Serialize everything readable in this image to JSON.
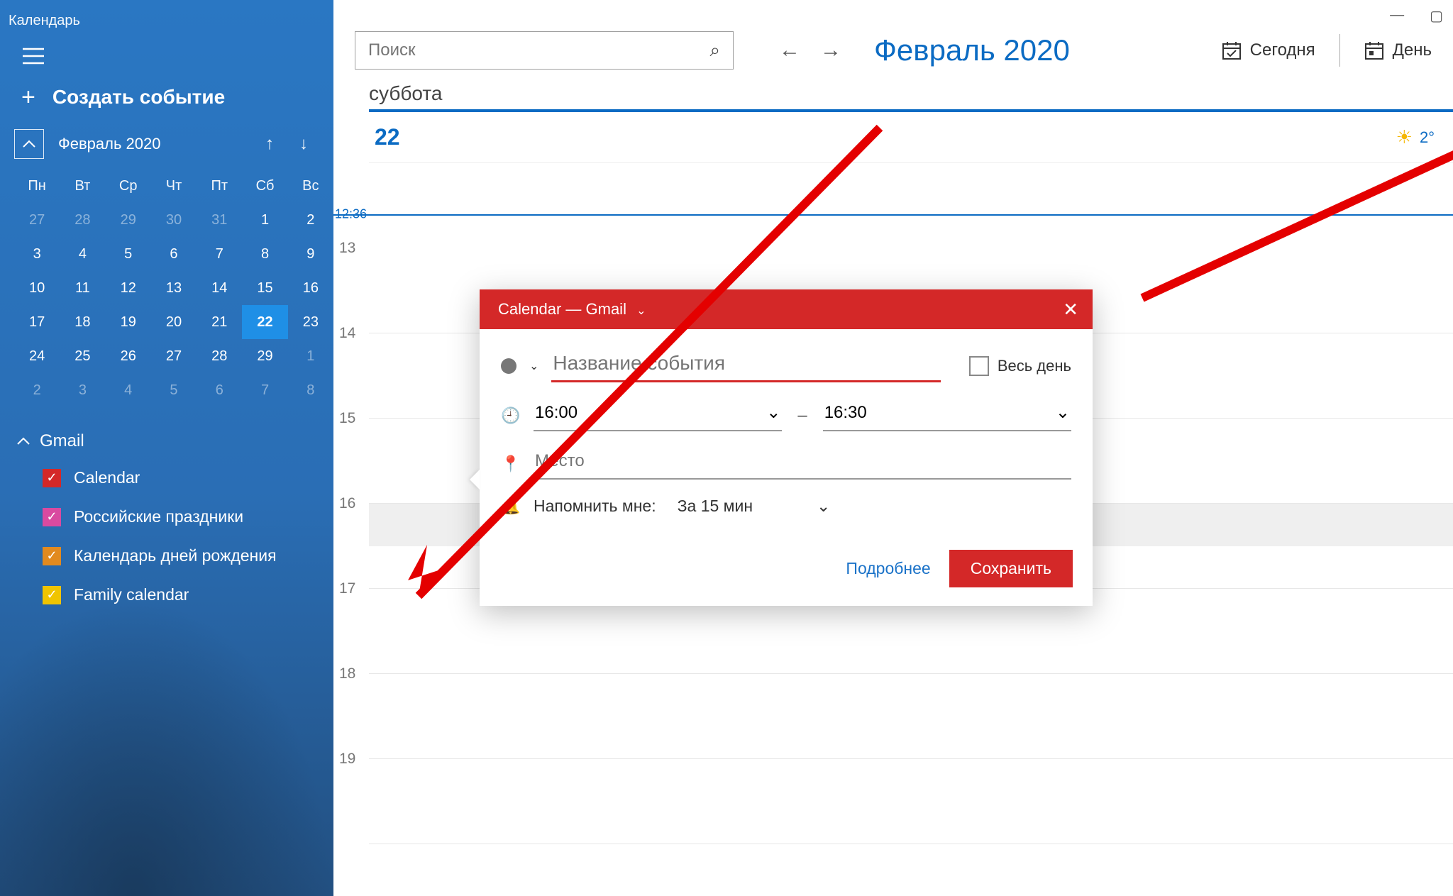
{
  "app_title": "Календарь",
  "create_event_label": "Создать событие",
  "mini_month_label": "Февраль 2020",
  "weekdays": [
    "Пн",
    "Вт",
    "Ср",
    "Чт",
    "Пт",
    "Сб",
    "Вс"
  ],
  "mini_cal_rows": [
    [
      {
        "d": "27",
        "dim": true
      },
      {
        "d": "28",
        "dim": true
      },
      {
        "d": "29",
        "dim": true
      },
      {
        "d": "30",
        "dim": true
      },
      {
        "d": "31",
        "dim": true
      },
      {
        "d": "1"
      },
      {
        "d": "2"
      }
    ],
    [
      {
        "d": "3"
      },
      {
        "d": "4"
      },
      {
        "d": "5"
      },
      {
        "d": "6"
      },
      {
        "d": "7"
      },
      {
        "d": "8"
      },
      {
        "d": "9"
      }
    ],
    [
      {
        "d": "10"
      },
      {
        "d": "11"
      },
      {
        "d": "12"
      },
      {
        "d": "13"
      },
      {
        "d": "14"
      },
      {
        "d": "15"
      },
      {
        "d": "16"
      }
    ],
    [
      {
        "d": "17"
      },
      {
        "d": "18"
      },
      {
        "d": "19"
      },
      {
        "d": "20"
      },
      {
        "d": "21"
      },
      {
        "d": "22",
        "sel": true
      },
      {
        "d": "23"
      }
    ],
    [
      {
        "d": "24"
      },
      {
        "d": "25"
      },
      {
        "d": "26"
      },
      {
        "d": "27"
      },
      {
        "d": "28"
      },
      {
        "d": "29"
      },
      {
        "d": "1",
        "dim": true
      }
    ],
    [
      {
        "d": "2",
        "dim": true
      },
      {
        "d": "3",
        "dim": true
      },
      {
        "d": "4",
        "dim": true
      },
      {
        "d": "5",
        "dim": true
      },
      {
        "d": "6",
        "dim": true
      },
      {
        "d": "7",
        "dim": true
      },
      {
        "d": "8",
        "dim": true
      }
    ]
  ],
  "account_name": "Gmail",
  "calendars": [
    {
      "label": "Calendar",
      "color": "#d42828"
    },
    {
      "label": "Российские праздники",
      "color": "#d94aa0"
    },
    {
      "label": "Календарь дней рождения",
      "color": "#e28a1f"
    },
    {
      "label": "Family calendar",
      "color": "#f0c400"
    }
  ],
  "search_placeholder": "Поиск",
  "main_month_title": "Февраль 2020",
  "today_label": "Сегодня",
  "day_label": "День",
  "day_of_week": "суббота",
  "day_number": "22",
  "weather_temp": "2°",
  "now_time_label": "12:36",
  "hours": [
    "13",
    "14",
    "15",
    "16",
    "17",
    "18",
    "19"
  ],
  "popover": {
    "header": "Calendar — Gmail",
    "title_placeholder": "Название события",
    "all_day_label": "Весь день",
    "time_start": "16:00",
    "time_end": "16:30",
    "location_placeholder": "Место",
    "remind_label": "Напомнить мне:",
    "remind_value": "За 15 мин",
    "more_label": "Подробнее",
    "save_label": "Сохранить"
  }
}
